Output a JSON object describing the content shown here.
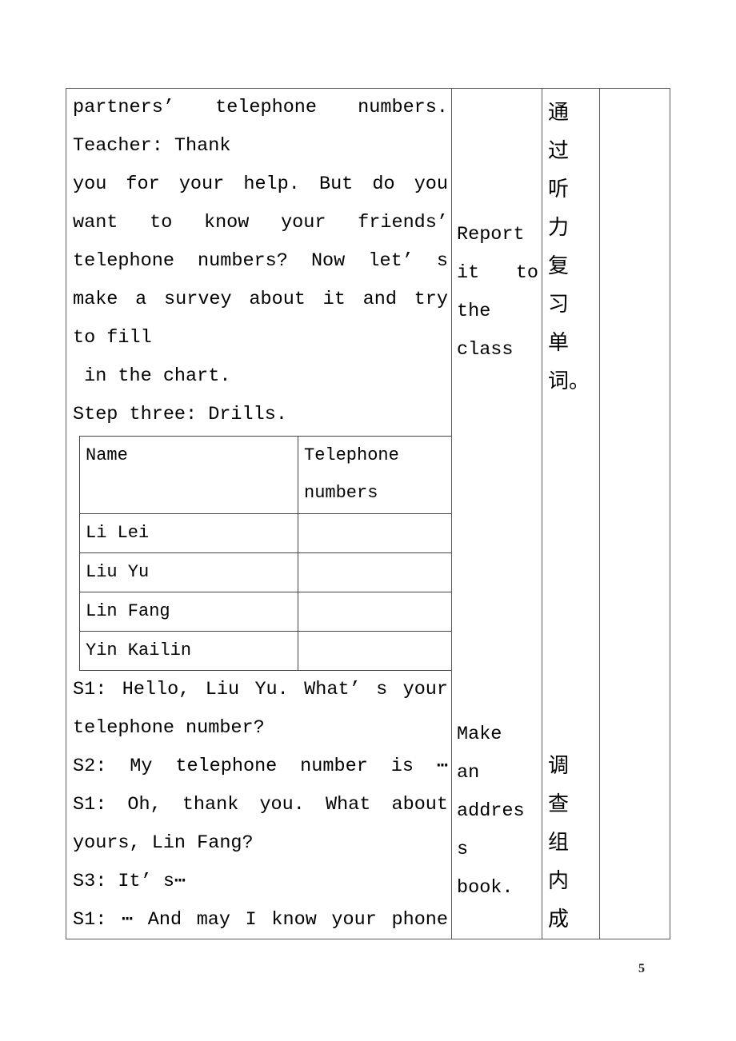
{
  "page": {
    "number": "5"
  },
  "lesson_table": {
    "content_column": {
      "lines_before_table": [
        "partners’  telephone numbers.",
        "Teacher: Thank",
        "you for your help. But do you",
        "want to know your friends’",
        "telephone numbers? Now let’ s",
        "make a survey about it and try",
        "to fill",
        " in the chart.",
        "Step three: Drills."
      ],
      "lines_before_table_justify": [
        true,
        false,
        true,
        true,
        true,
        true,
        false,
        false,
        false
      ],
      "survey_table": {
        "headers": [
          "Name",
          "Telephone numbers"
        ],
        "header_line_1": "Telephone",
        "header_line_2": "numbers",
        "rows": [
          {
            "name": "Li Lei",
            "telephone": ""
          },
          {
            "name": "Liu Yu",
            "telephone": ""
          },
          {
            "name": "Lin Fang",
            "telephone": ""
          },
          {
            "name": "Yin Kailin",
            "telephone": ""
          }
        ]
      },
      "lines_after_table": [
        "S1: Hello, Liu Yu. What’ s your",
        "telephone number?",
        "S2: My telephone number is ⋯",
        "S1: Oh, thank you. What about",
        "yours, Lin Fang?",
        "S3: It’ s⋯",
        "S1: ⋯ And may I know your phone"
      ],
      "lines_after_table_justify": [
        true,
        false,
        true,
        true,
        false,
        false,
        true
      ]
    },
    "purpose_column": {
      "block_one": [
        "Report",
        "it  to",
        "the",
        "class"
      ],
      "block_one_justify": [
        false,
        true,
        false,
        false
      ],
      "block_two": [
        "Make",
        "an",
        "addres",
        "s",
        "book."
      ],
      "block_two_justify": [
        false,
        false,
        false,
        false,
        false
      ]
    },
    "chinese_column": {
      "block_one": [
        "通",
        "过",
        "听",
        "力",
        "复",
        "习",
        "单",
        "词。"
      ],
      "block_two": [
        "调",
        "查",
        "组",
        "内",
        "成"
      ]
    },
    "extra_column": {
      "content": ""
    }
  }
}
